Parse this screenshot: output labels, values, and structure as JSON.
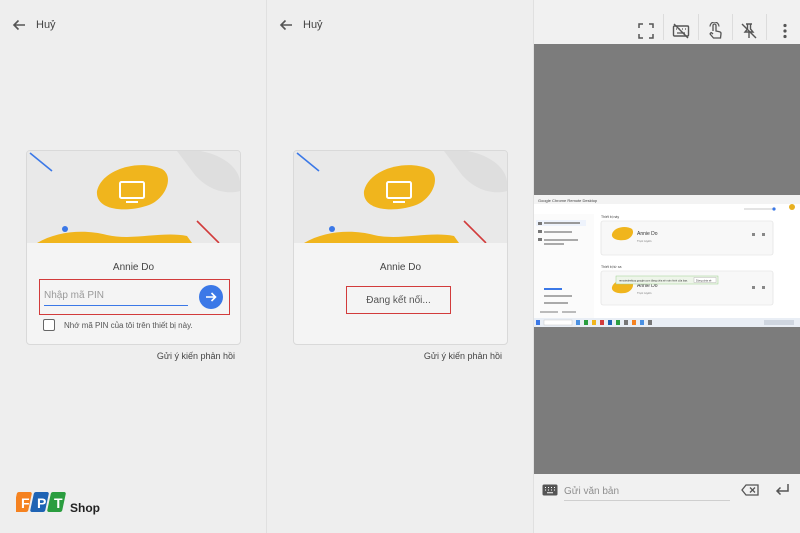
{
  "panels": [
    {
      "cancel_label": "Huỷ",
      "user_name": "Annie Do",
      "pin_placeholder": "Nhập mã PIN",
      "remember_label": "Nhớ mã PIN của tôi trên thiết bị này.",
      "feedback_label": "Gửi ý kiến phản hồi"
    },
    {
      "cancel_label": "Huỷ",
      "user_name": "Annie Do",
      "connecting_label": "Đang kết nối...",
      "feedback_label": "Gửi ý kiến phản hồi"
    }
  ],
  "remote_panel": {
    "toolbar_icons": [
      "fullscreen-icon",
      "keyboard-off-icon",
      "touch-icon",
      "pin-off-icon"
    ],
    "text_placeholder": "Gửi văn bản",
    "bottom_icons": [
      "keyboard-icon",
      "backspace-icon",
      "enter-icon"
    ]
  },
  "remote_desktop": {
    "window_title": "Google Chrome Remote Desktop",
    "section_this_device": "Thiết bị này",
    "section_remote": "Thiết bị từ xa",
    "device_name": "Annie Do",
    "device_status": "Trực tuyến",
    "share_bar_text": "remotedesktop.google.com đang chia sẻ màn hình của bạn.",
    "share_bar_button": "Dừng chia sẻ"
  },
  "logo": {
    "shop_label": "Shop"
  },
  "colors": {
    "accent_blue": "#3b78e7",
    "highlight_red": "#d23b3b",
    "illustration_yellow": "#f0b51d",
    "logo_orange": "#f58220",
    "logo_blue": "#1e63b4",
    "logo_green": "#2a9d3f"
  }
}
